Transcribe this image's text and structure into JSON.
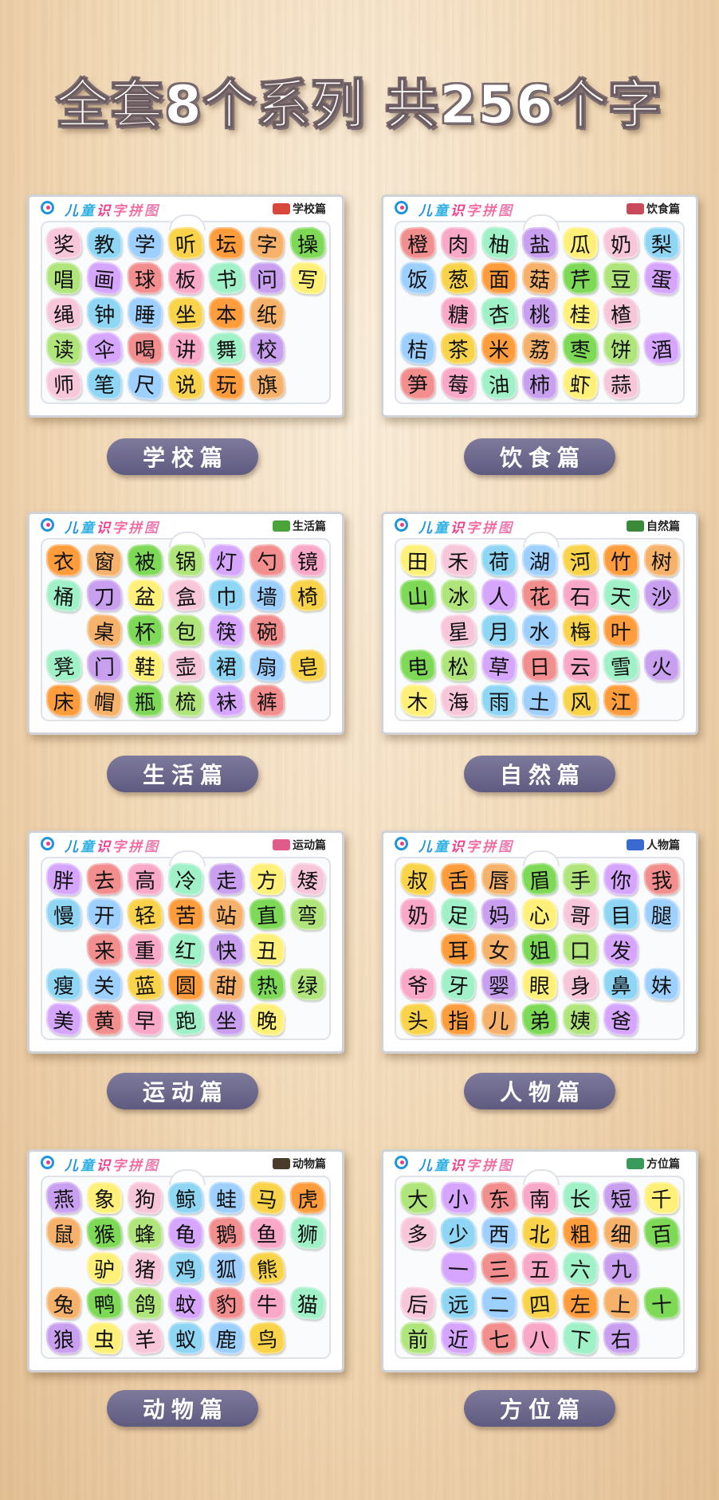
{
  "headline": "全套8个系列 共256个字",
  "brand": [
    "儿",
    "童",
    "识",
    "字",
    "拼",
    "图"
  ],
  "boards": [
    {
      "label": "学校篇",
      "series": "学校篇",
      "icon_name": "school-icon",
      "icon_color": "#d9463a",
      "chars": [
        "奖",
        "教",
        "学",
        "听",
        "坛",
        "字",
        "操",
        "唱",
        "画",
        "球",
        "板",
        "书",
        "问",
        "写",
        "绳",
        "钟",
        "睡",
        "坐",
        "本",
        "纸",
        "",
        "读",
        "伞",
        "喝",
        "讲",
        "舞",
        "校",
        "",
        "师",
        "笔",
        "尺",
        "说",
        "玩",
        "旗",
        ""
      ]
    },
    {
      "label": "饮食篇",
      "series": "饮食篇",
      "icon_name": "food-bowl-icon",
      "icon_color": "#c94a5a",
      "chars": [
        "橙",
        "肉",
        "柚",
        "盐",
        "瓜",
        "奶",
        "梨",
        "饭",
        "葱",
        "面",
        "菇",
        "芹",
        "豆",
        "蛋",
        "",
        "糖",
        "杏",
        "桃",
        "桂",
        "楂",
        "",
        "桔",
        "茶",
        "米",
        "荔",
        "枣",
        "饼",
        "酒",
        "笋",
        "莓",
        "油",
        "柿",
        "虾",
        "蒜",
        ""
      ]
    },
    {
      "label": "生活篇",
      "series": "生活篇",
      "icon_name": "umbrella-icon",
      "icon_color": "#4aa43a",
      "chars": [
        "衣",
        "窗",
        "被",
        "锅",
        "灯",
        "勺",
        "镜",
        "桶",
        "刀",
        "盆",
        "盒",
        "巾",
        "墙",
        "椅",
        "",
        "桌",
        "杯",
        "包",
        "筷",
        "碗",
        "",
        "凳",
        "门",
        "鞋",
        "壶",
        "裙",
        "扇",
        "皂",
        "床",
        "帽",
        "瓶",
        "梳",
        "袜",
        "裤",
        ""
      ]
    },
    {
      "label": "自然篇",
      "series": "自然篇",
      "icon_name": "mountain-icon",
      "icon_color": "#3a8a3a",
      "chars": [
        "田",
        "禾",
        "荷",
        "湖",
        "河",
        "竹",
        "树",
        "山",
        "冰",
        "人",
        "花",
        "石",
        "天",
        "沙",
        "",
        "星",
        "月",
        "水",
        "梅",
        "叶",
        "",
        "电",
        "松",
        "草",
        "日",
        "云",
        "雪",
        "火",
        "木",
        "海",
        "雨",
        "土",
        "风",
        "江",
        ""
      ]
    },
    {
      "label": "运动篇",
      "series": "运动篇",
      "icon_name": "runner-icon",
      "icon_color": "#e05a8a",
      "chars": [
        "胖",
        "去",
        "高",
        "冷",
        "走",
        "方",
        "矮",
        "慢",
        "开",
        "轻",
        "苦",
        "站",
        "直",
        "弯",
        "",
        "来",
        "重",
        "红",
        "快",
        "丑",
        "",
        "瘦",
        "关",
        "蓝",
        "圆",
        "甜",
        "热",
        "绿",
        "美",
        "黄",
        "早",
        "跑",
        "坐",
        "晚",
        ""
      ]
    },
    {
      "label": "人物篇",
      "series": "人物篇",
      "icon_name": "people-icon",
      "icon_color": "#3a6ad0",
      "chars": [
        "叔",
        "舌",
        "唇",
        "眉",
        "手",
        "你",
        "我",
        "奶",
        "足",
        "妈",
        "心",
        "哥",
        "目",
        "腿",
        "",
        "耳",
        "女",
        "姐",
        "口",
        "发",
        "",
        "爷",
        "牙",
        "婴",
        "眼",
        "身",
        "鼻",
        "妹",
        "头",
        "指",
        "儿",
        "弟",
        "姨",
        "爸",
        ""
      ]
    },
    {
      "label": "动物篇",
      "series": "动物篇",
      "icon_name": "eagle-icon",
      "icon_color": "#4a3a2a",
      "chars": [
        "燕",
        "象",
        "狗",
        "鲸",
        "蛙",
        "马",
        "虎",
        "鼠",
        "猴",
        "蜂",
        "龟",
        "鹅",
        "鱼",
        "狮",
        "",
        "驴",
        "猪",
        "鸡",
        "狐",
        "熊",
        "",
        "兔",
        "鸭",
        "鸽",
        "蚊",
        "豹",
        "牛",
        "猫",
        "狼",
        "虫",
        "羊",
        "蚁",
        "鹿",
        "鸟",
        ""
      ]
    },
    {
      "label": "方位篇",
      "series": "方位篇",
      "icon_name": "compass-icon",
      "icon_color": "#3a9a5a",
      "chars": [
        "大",
        "小",
        "东",
        "南",
        "长",
        "短",
        "千",
        "多",
        "少",
        "西",
        "北",
        "粗",
        "细",
        "百",
        "",
        "一",
        "三",
        "五",
        "六",
        "九",
        "",
        "后",
        "远",
        "二",
        "四",
        "左",
        "上",
        "十",
        "前",
        "近",
        "七",
        "八",
        "下",
        "右",
        ""
      ]
    }
  ],
  "tile_colors": [
    "#f7c6d9",
    "#f9d34a",
    "#7ed957",
    "#f28e8e",
    "#c9a0f0",
    "#8fd6f5",
    "#ff9d3d",
    "#b0e57c",
    "#f9a8c8",
    "#fff07a",
    "#9ed0ff",
    "#f6b26b",
    "#d6a6ff",
    "#a0f0c8"
  ]
}
